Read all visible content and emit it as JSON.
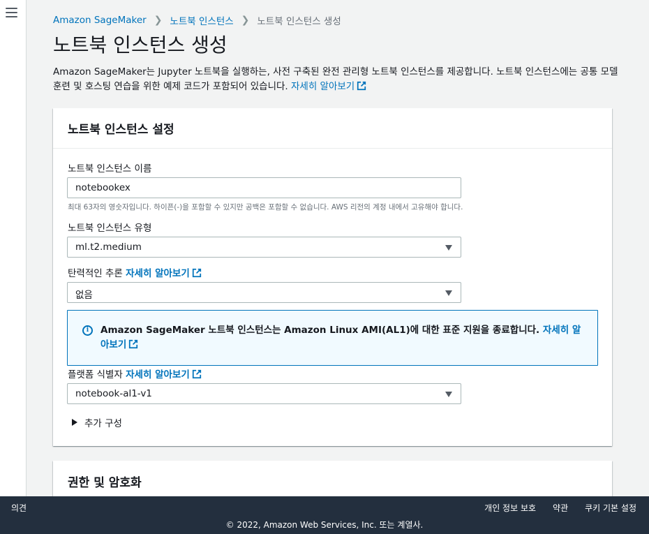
{
  "nav": {
    "menu_icon": "hamburger-menu-icon"
  },
  "breadcrumb": {
    "items": [
      "Amazon SageMaker",
      "노트북 인스턴스",
      "노트북 인스턴스 생성"
    ],
    "separator_icon": "chevron-right-icon"
  },
  "page": {
    "title": "노트북 인스턴스 생성",
    "intro_text": "Amazon SageMaker는 Jupyter 노트북을 실행하는, 사전 구축된 완전 관리형 노트북 인스턴스를 제공합니다. 노트북 인스턴스에는 공통 모델 훈련 및 호스팅 연습을 위한 예제 코드가 포함되어 있습니다.",
    "intro_link": "자세히 알아보기"
  },
  "settings_panel": {
    "title": "노트북 인스턴스 설정",
    "name_label": "노트북 인스턴스 이름",
    "name_value": "notebookex",
    "name_hint": "최대 63자의 영숫자입니다. 하이픈(-)을 포함할 수 있지만 공백은 포함할 수 없습니다. AWS 리전의 계정 내에서 고유해야 합니다.",
    "type_label": "노트북 인스턴스 유형",
    "type_value": "ml.t2.medium",
    "elastic_label": "탄력적인 추론",
    "elastic_link": "자세히 알아보기",
    "elastic_value": "없음",
    "alert_text": "Amazon SageMaker 노트북 인스턴스는 Amazon Linux AMI(AL1)에 대한 표준 지원을 종료합니다.",
    "alert_link": "자세히 알아보기",
    "platform_label": "플랫폼 식별자",
    "platform_link": "자세히 알아보기",
    "platform_value": "notebook-al1-v1",
    "additional_config": "추가 구성"
  },
  "permissions_panel": {
    "title": "권한 및 암호화"
  },
  "footer": {
    "feedback": "의견",
    "links": [
      "개인 정보 보호",
      "약관",
      "쿠키 기본 설정"
    ],
    "copyright": "© 2022, Amazon Web Services, Inc. 또는 계열사."
  },
  "colors": {
    "link": "#0073bb",
    "footer_bg": "#232f3e",
    "alert_bg": "#f1faff"
  }
}
